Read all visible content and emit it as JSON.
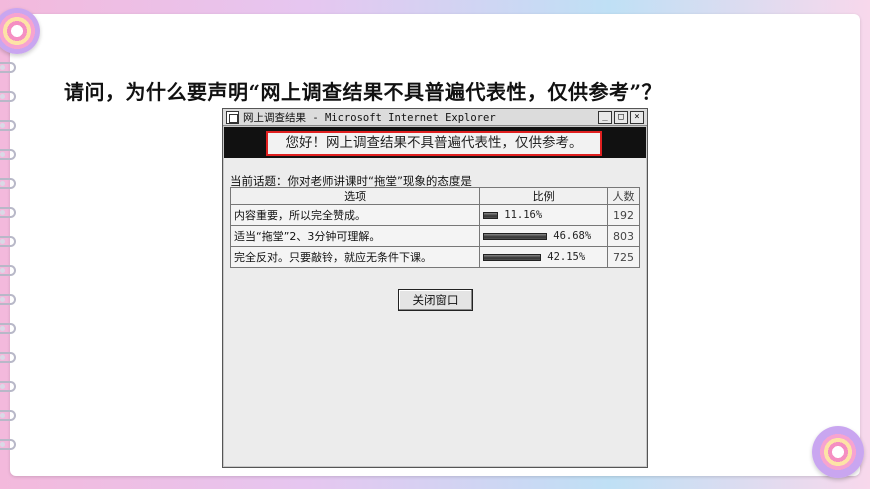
{
  "question": "请问，为什么要声明“网上调查结果不具普遍代表性，仅供参考”？",
  "window": {
    "title": "网上调查结果 - Microsoft Internet Explorer",
    "controls": {
      "minimize": "_",
      "maximize": "□",
      "close": "×"
    },
    "banner": "您好！网上调查结果不具普遍代表性，仅供参考。",
    "topic": "当前话题：你对老师讲课时“拖堂”现象的态度是",
    "table": {
      "headers": {
        "option": "选项",
        "percent": "比例",
        "count": "人数"
      },
      "rows": [
        {
          "option": "内容重要，所以完全赞成。",
          "percent_label": "11.16%",
          "percent": 11.16,
          "count": "192"
        },
        {
          "option": "适当“拖堂”2、3分钟可理解。",
          "percent_label": "46.68%",
          "percent": 46.68,
          "count": "803"
        },
        {
          "option": "完全反对。只要敲铃，就应无条件下课。",
          "percent_label": "42.15%",
          "percent": 42.15,
          "count": "725"
        }
      ]
    },
    "close_button": "关闭窗口"
  }
}
